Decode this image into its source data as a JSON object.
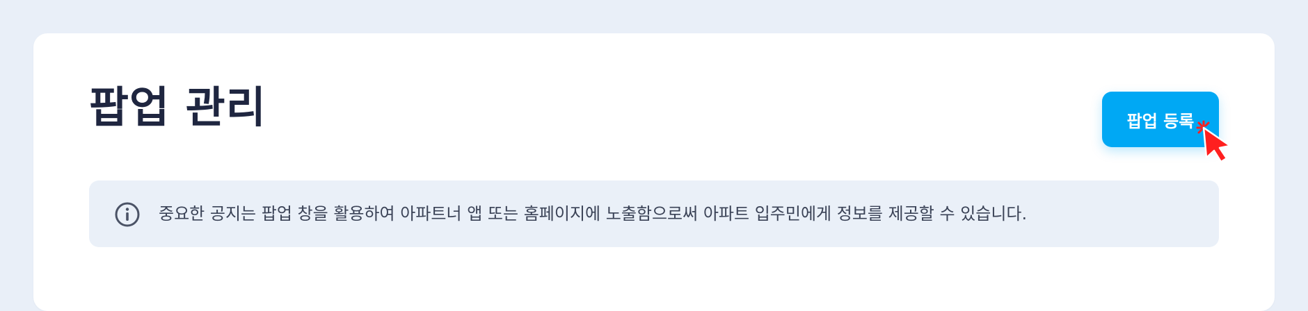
{
  "page": {
    "title": "팝업 관리",
    "register_button_label": "팝업 등록"
  },
  "notice": {
    "icon": "info-circle-icon",
    "text": "중요한 공지는 팝업 창을 활용하여 아파트너 앱 또는 홈페이지에 노출함으로써 아파트 입주민에게 정보를 제공할 수 있습니다."
  },
  "pointer": {
    "icon": "cursor-click-icon"
  },
  "colors": {
    "background": "#e9eff8",
    "card": "#ffffff",
    "title": "#1f2640",
    "primary_button": "#00a8f4",
    "notice_background": "#eaf0f8",
    "notice_text": "#3a4256",
    "cursor": "#ff1f1f"
  }
}
